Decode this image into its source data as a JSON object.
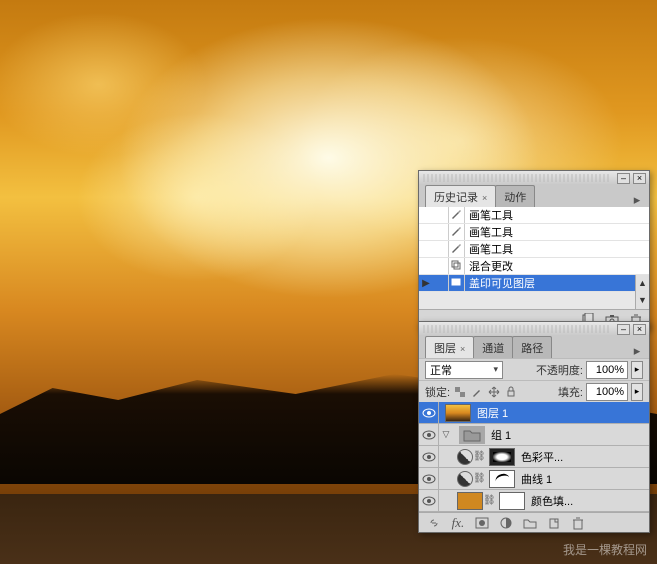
{
  "history_panel": {
    "tabs": [
      {
        "label": "历史记录",
        "active": true
      },
      {
        "label": "动作",
        "active": false
      }
    ],
    "items": [
      {
        "icon": "brush",
        "label": "画笔工具",
        "selected": false
      },
      {
        "icon": "brush",
        "label": "画笔工具",
        "selected": false
      },
      {
        "icon": "brush",
        "label": "画笔工具",
        "selected": false
      },
      {
        "icon": "blend",
        "label": "混合更改",
        "selected": false
      },
      {
        "icon": "stamp",
        "label": "盖印可见图层",
        "selected": true
      }
    ]
  },
  "layers_panel": {
    "tabs": [
      {
        "label": "图层",
        "active": true
      },
      {
        "label": "通道",
        "active": false
      },
      {
        "label": "路径",
        "active": false
      }
    ],
    "blend_mode": "正常",
    "opacity_label": "不透明度:",
    "opacity_value": "100%",
    "lock_label": "锁定:",
    "fill_label": "填充:",
    "fill_value": "100%",
    "layers": [
      {
        "type": "layer",
        "name": "图层 1",
        "thumb": "sunset",
        "selected": true,
        "indent": 0
      },
      {
        "type": "group",
        "name": "组 1",
        "selected": false,
        "indent": 0
      },
      {
        "type": "adjustment",
        "name": "色彩平...",
        "thumb": "adj",
        "mask": "maskwhite",
        "indent": 1
      },
      {
        "type": "adjustment",
        "name": "曲线 1",
        "thumb": "adj",
        "mask": "curves",
        "indent": 1
      },
      {
        "type": "fill",
        "name": "颜色填...",
        "thumb": "solid",
        "mask": "maskwhite",
        "indent": 1
      }
    ]
  },
  "watermark": "我是一棵教程网"
}
